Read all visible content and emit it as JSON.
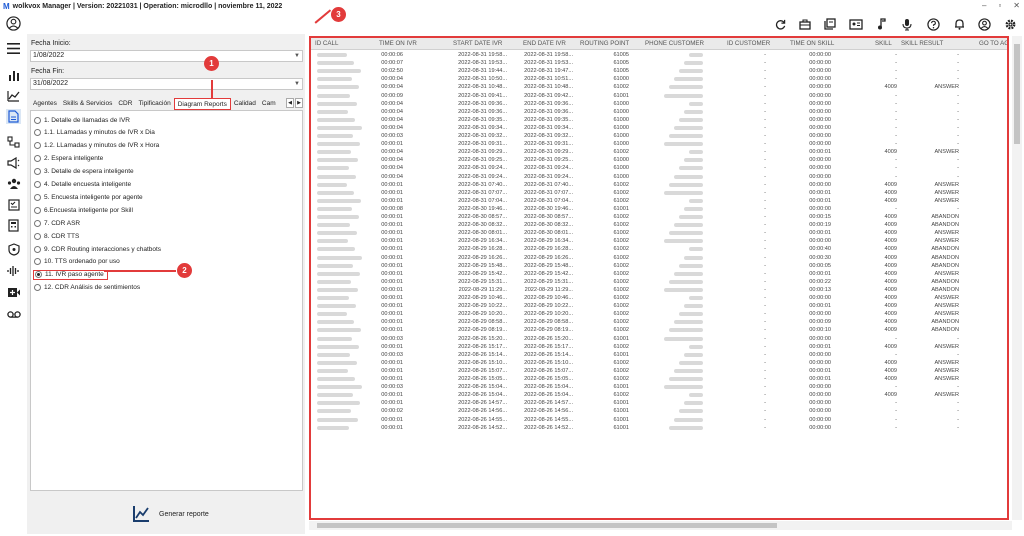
{
  "app": {
    "title": "wolkvox Manager  | Version: 20221031 |  Operation: microdllo | noviembre 11, 2022",
    "window_controls": [
      "–",
      "▫",
      "✕"
    ]
  },
  "sidebar_icons": [
    "user-icon",
    "menu-icon",
    "bar-chart-icon",
    "trend-icon",
    "report-icon",
    "flow-icon",
    "megaphone-icon",
    "group-icon",
    "check-list-icon",
    "calculator-icon",
    "shield-icon",
    "waveform-icon",
    "video-icon",
    "voicemail-icon"
  ],
  "toolbar_icons": [
    "refresh-icon",
    "briefcase-icon",
    "library-icon",
    "id-card-icon",
    "music-icon",
    "microphone-icon",
    "help-icon",
    "bell-icon",
    "account-icon",
    "settings-icon"
  ],
  "filters": {
    "start_label": "Fecha Inicio:",
    "start_value": "1/08/2022",
    "end_label": "Fecha Fin:",
    "end_value": "31/08/2022"
  },
  "tabs": [
    "Agentes",
    "Skills & Servicios",
    "CDR",
    "Tipificación",
    "Diagram Reports",
    "Calidad",
    "Cam"
  ],
  "active_tab": "Diagram Reports",
  "reports": [
    "1. Detalle de llamadas de IVR",
    "1.1. LLamadas y minutos de IVR x Dia",
    "1.2. LLamadas y minutos de IVR x Hora",
    "2. Espera inteligente",
    "3. Detalle de espera inteligente",
    "4. Detalle encuesta inteligente",
    "5. Encuesta inteligente por agente",
    "6.Encuesta inteligente por Skill",
    "7. CDR ASR",
    "8. CDR TTS",
    "9. CDR Routing interacciones y chatbots",
    "10. TTS ordenado por uso",
    "11. IVR paso agente",
    "12. CDR Análisis de sentimientos"
  ],
  "selected_report": "11. IVR paso agente",
  "generate_label": "Generar reporte",
  "badges": [
    "1",
    "2",
    "3"
  ],
  "grid": {
    "columns": [
      "ID CALL",
      "TIME ON IVR",
      "START DATE IVR",
      "END DATE IVR",
      "ROUTING POINT",
      "PHONE CUSTOMER",
      "ID CUSTOMER",
      "TIME ON SKILL",
      "SKILL",
      "SKILL RESULT",
      "GO TO AG"
    ],
    "rows": [
      [
        "00:00:06",
        "2022-08-31 19:58...",
        "2022-08-31 19:58...",
        "61005",
        "-",
        "00:00:00",
        "-",
        "-"
      ],
      [
        "00:00:07",
        "2022-08-31 19:53...",
        "2022-08-31 19:53...",
        "61005",
        "-",
        "00:00:00",
        "-",
        "-"
      ],
      [
        "00:02:50",
        "2022-08-31 19:44...",
        "2022-08-31 19:47...",
        "61005",
        "-",
        "00:00:00",
        "-",
        "-"
      ],
      [
        "00:00:04",
        "2022-08-31 10:50...",
        "2022-08-31 10:51...",
        "61000",
        "-",
        "00:00:00",
        "-",
        "-"
      ],
      [
        "00:00:04",
        "2022-08-31 10:48...",
        "2022-08-31 10:48...",
        "61002",
        "-",
        "00:00:00",
        "4009",
        "ANSWER"
      ],
      [
        "00:00:09",
        "2022-08-31 09:41...",
        "2022-08-31 09:42...",
        "61001",
        "-",
        "00:00:00",
        "-",
        "-"
      ],
      [
        "00:00:04",
        "2022-08-31 09:36...",
        "2022-08-31 09:36...",
        "61000",
        "-",
        "00:00:00",
        "-",
        "-"
      ],
      [
        "00:00:04",
        "2022-08-31 09:36...",
        "2022-08-31 09:36...",
        "61000",
        "-",
        "00:00:00",
        "-",
        "-"
      ],
      [
        "00:00:04",
        "2022-08-31 09:35...",
        "2022-08-31 09:35...",
        "61000",
        "-",
        "00:00:00",
        "-",
        "-"
      ],
      [
        "00:00:04",
        "2022-08-31 09:34...",
        "2022-08-31 09:34...",
        "61000",
        "-",
        "00:00:00",
        "-",
        "-"
      ],
      [
        "00:00:03",
        "2022-08-31 09:32...",
        "2022-08-31 09:32...",
        "61000",
        "-",
        "00:00:00",
        "-",
        "-"
      ],
      [
        "00:00:01",
        "2022-08-31 09:31...",
        "2022-08-31 09:31...",
        "61000",
        "-",
        "00:00:00",
        "-",
        "-"
      ],
      [
        "00:00:04",
        "2022-08-31 09:29...",
        "2022-08-31 09:29...",
        "61002",
        "-",
        "00:00:01",
        "4009",
        "ANSWER"
      ],
      [
        "00:00:04",
        "2022-08-31 09:25...",
        "2022-08-31 09:25...",
        "61000",
        "-",
        "00:00:00",
        "-",
        "-"
      ],
      [
        "00:00:04",
        "2022-08-31 09:24...",
        "2022-08-31 09:24...",
        "61000",
        "-",
        "00:00:00",
        "-",
        "-"
      ],
      [
        "00:00:04",
        "2022-08-31 09:24...",
        "2022-08-31 09:24...",
        "61000",
        "-",
        "00:00:00",
        "-",
        "-"
      ],
      [
        "00:00:01",
        "2022-08-31 07:40...",
        "2022-08-31 07:40...",
        "61002",
        "-",
        "00:00:00",
        "4009",
        "ANSWER"
      ],
      [
        "00:00:01",
        "2022-08-31 07:07...",
        "2022-08-31 07:07...",
        "61002",
        "-",
        "00:00:01",
        "4009",
        "ANSWER"
      ],
      [
        "00:00:01",
        "2022-08-31 07:04...",
        "2022-08-31 07:04...",
        "61002",
        "-",
        "00:00:01",
        "4009",
        "ANSWER"
      ],
      [
        "00:00:08",
        "2022-08-30 19:46...",
        "2022-08-30 19:46...",
        "61001",
        "-",
        "00:00:00",
        "-",
        "-"
      ],
      [
        "00:00:01",
        "2022-08-30 08:57...",
        "2022-08-30 08:57...",
        "61002",
        "-",
        "00:00:15",
        "4009",
        "ABANDON"
      ],
      [
        "00:00:01",
        "2022-08-30 08:32...",
        "2022-08-30 08:32...",
        "61002",
        "-",
        "00:00:19",
        "4009",
        "ABANDON"
      ],
      [
        "00:00:01",
        "2022-08-30 08:01...",
        "2022-08-30 08:01...",
        "61002",
        "-",
        "00:00:01",
        "4009",
        "ANSWER"
      ],
      [
        "00:00:01",
        "2022-08-29 16:34...",
        "2022-08-29 16:34...",
        "61002",
        "-",
        "00:00:00",
        "4009",
        "ANSWER"
      ],
      [
        "00:00:01",
        "2022-08-29 16:28...",
        "2022-08-29 16:28...",
        "61002",
        "-",
        "00:00:40",
        "4009",
        "ABANDON"
      ],
      [
        "00:00:01",
        "2022-08-29 16:26...",
        "2022-08-29 16:26...",
        "61002",
        "-",
        "00:00:30",
        "4009",
        "ABANDON"
      ],
      [
        "00:00:01",
        "2022-08-29 15:48...",
        "2022-08-29 15:48...",
        "61002",
        "-",
        "00:00:05",
        "4009",
        "ABANDON"
      ],
      [
        "00:00:01",
        "2022-08-29 15:42...",
        "2022-08-29 15:42...",
        "61002",
        "-",
        "00:00:01",
        "4009",
        "ANSWER"
      ],
      [
        "00:00:01",
        "2022-08-29 15:31...",
        "2022-08-29 15:31...",
        "61002",
        "-",
        "00:00:22",
        "4009",
        "ABANDON"
      ],
      [
        "00:00:01",
        "2022-08-29 11:29...",
        "2022-08-29 11:29...",
        "61002",
        "-",
        "00:00:13",
        "4009",
        "ABANDON"
      ],
      [
        "00:00:01",
        "2022-08-29 10:46...",
        "2022-08-29 10:46...",
        "61002",
        "-",
        "00:00:00",
        "4009",
        "ANSWER"
      ],
      [
        "00:00:01",
        "2022-08-29 10:22...",
        "2022-08-29 10:22...",
        "61002",
        "-",
        "00:00:01",
        "4009",
        "ANSWER"
      ],
      [
        "00:00:01",
        "2022-08-29 10:20...",
        "2022-08-29 10:20...",
        "61002",
        "-",
        "00:00:00",
        "4009",
        "ANSWER"
      ],
      [
        "00:00:01",
        "2022-08-29 08:58...",
        "2022-08-29 08:58...",
        "61002",
        "-",
        "00:00:09",
        "4009",
        "ABANDON"
      ],
      [
        "00:00:01",
        "2022-08-29 08:19...",
        "2022-08-29 08:19...",
        "61002",
        "-",
        "00:00:10",
        "4009",
        "ABANDON"
      ],
      [
        "00:00:03",
        "2022-08-26 15:20...",
        "2022-08-26 15:20...",
        "61001",
        "-",
        "00:00:00",
        "-",
        "-"
      ],
      [
        "00:00:01",
        "2022-08-26 15:17...",
        "2022-08-26 15:17...",
        "61002",
        "-",
        "00:00:01",
        "4009",
        "ANSWER"
      ],
      [
        "00:00:03",
        "2022-08-26 15:14...",
        "2022-08-26 15:14...",
        "61001",
        "-",
        "00:00:00",
        "-",
        "-"
      ],
      [
        "00:00:01",
        "2022-08-26 15:10...",
        "2022-08-26 15:10...",
        "61002",
        "-",
        "00:00:00",
        "4009",
        "ANSWER"
      ],
      [
        "00:00:01",
        "2022-08-26 15:07...",
        "2022-08-26 15:07...",
        "61002",
        "-",
        "00:00:01",
        "4009",
        "ANSWER"
      ],
      [
        "00:00:01",
        "2022-08-26 15:05...",
        "2022-08-26 15:05...",
        "61002",
        "-",
        "00:00:01",
        "4009",
        "ANSWER"
      ],
      [
        "00:00:03",
        "2022-08-26 15:04...",
        "2022-08-26 15:04...",
        "61001",
        "-",
        "00:00:00",
        "-",
        "-"
      ],
      [
        "00:00:01",
        "2022-08-26 15:04...",
        "2022-08-26 15:04...",
        "61002",
        "-",
        "00:00:00",
        "4009",
        "ANSWER"
      ],
      [
        "00:00:01",
        "2022-08-26 14:57...",
        "2022-08-26 14:57...",
        "61001",
        "-",
        "00:00:00",
        "-",
        "-"
      ],
      [
        "00:00:02",
        "2022-08-26 14:56...",
        "2022-08-26 14:56...",
        "61001",
        "-",
        "00:00:00",
        "-",
        "-"
      ],
      [
        "00:00:01",
        "2022-08-26 14:55...",
        "2022-08-26 14:55...",
        "61001",
        "-",
        "00:00:00",
        "-",
        "-"
      ],
      [
        "00:00:01",
        "2022-08-26 14:52...",
        "2022-08-26 14:52...",
        "61001",
        "-",
        "00:00:00",
        "-",
        "-"
      ]
    ]
  },
  "colors": {
    "accent_red": "#e23b3b",
    "header_bg": "#eaeaea",
    "blurred": "#d9d9d9"
  }
}
